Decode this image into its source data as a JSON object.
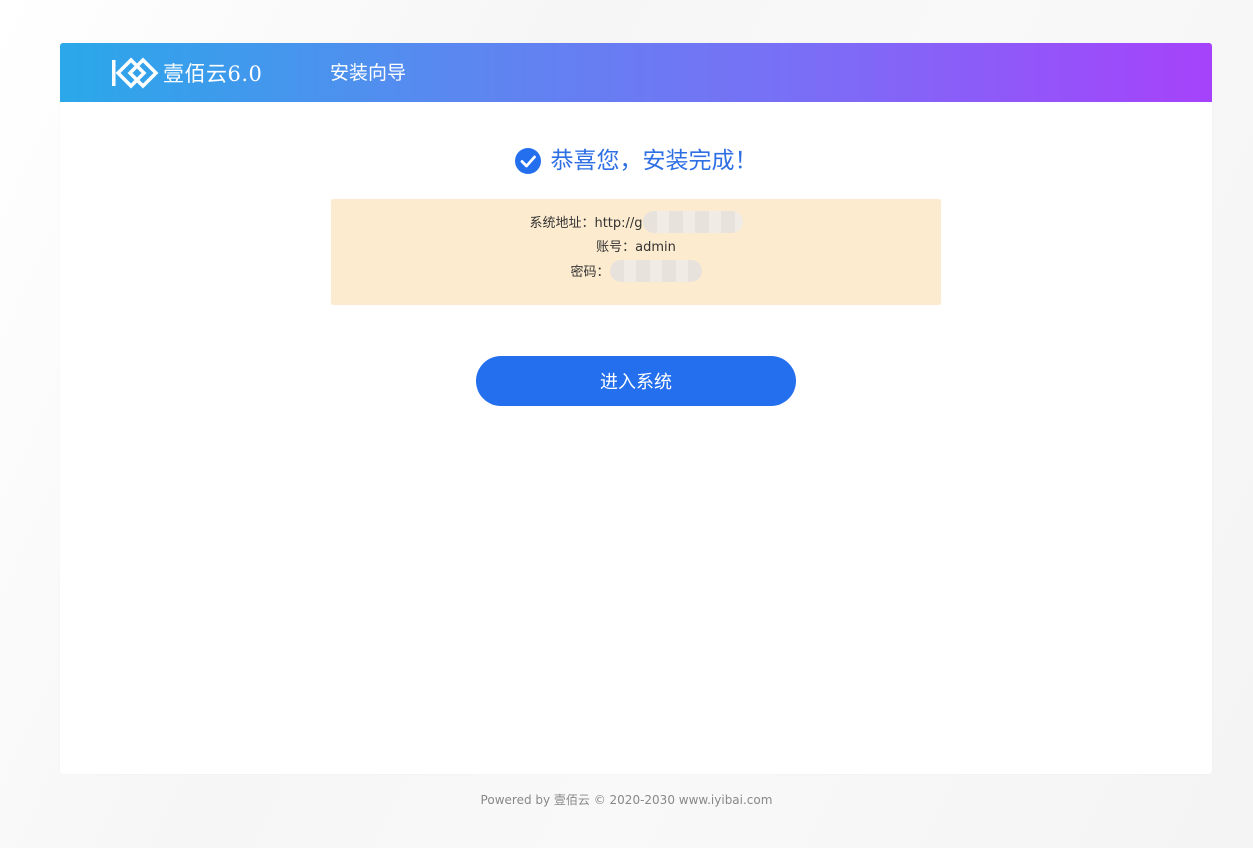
{
  "header": {
    "logo_text": "壹佰云6.0",
    "title": "安装向导"
  },
  "success": {
    "icon": "check-circle-icon",
    "message": "恭喜您，安装完成！"
  },
  "info": {
    "address_label": "系统地址：",
    "address_value": "http://g",
    "account_label": "账号：",
    "account_value": "admin",
    "password_label": "密码："
  },
  "actions": {
    "enter_label": "进入系统"
  },
  "footer": {
    "text": "Powered by 壹佰云 © 2020-2030 www.iyibai.com"
  },
  "colors": {
    "accent": "#236fee",
    "header_start": "#2aa8ea",
    "header_end": "#a642fb",
    "info_bg": "#fcebcf"
  }
}
